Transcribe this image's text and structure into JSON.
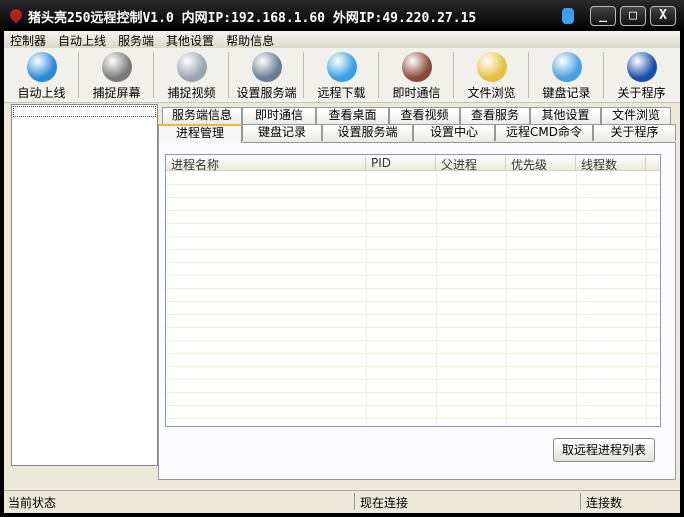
{
  "title": "猪头亮250远程控制V1.0 内网IP:192.168.1.60  外网IP:49.220.27.15",
  "window_buttons": {
    "minimize": "_",
    "maximize": "□",
    "close": "X"
  },
  "menu": [
    "控制器",
    "自动上线",
    "服务端",
    "其他设置",
    "帮助信息"
  ],
  "toolbar": [
    {
      "label": "自动上线",
      "icon": "globe-icon",
      "color": "#2a8ad8"
    },
    {
      "label": "捕捉屏幕",
      "icon": "camera-icon",
      "color": "#7a7a7a"
    },
    {
      "label": "捕捉视频",
      "icon": "webcam-icon",
      "color": "#9aa4ae"
    },
    {
      "label": "设置服务端",
      "icon": "toolbox-icon",
      "color": "#6a7f95"
    },
    {
      "label": "远程下载",
      "icon": "download-icon",
      "color": "#3a9ee0"
    },
    {
      "label": "即时通信",
      "icon": "heart-icon",
      "color": "#8a4a3a"
    },
    {
      "label": "文件浏览",
      "icon": "cabinet-icon",
      "color": "#e8c040"
    },
    {
      "label": "键盘记录",
      "icon": "computer-icon",
      "color": "#4aa0e0"
    },
    {
      "label": "关于程序",
      "icon": "help-icon",
      "color": "#1a4ea8"
    }
  ],
  "tabs_row1": [
    "服务端信息",
    "即时通信",
    "查看桌面",
    "查看视频",
    "查看服务",
    "其他设置",
    "文件浏览"
  ],
  "tabs_row2": [
    "进程管理",
    "键盘记录",
    "设置服务端",
    "设置中心",
    "远程CMD命令",
    "关于程序"
  ],
  "active_tab": "进程管理",
  "columns": [
    "进程名称",
    "PID",
    "父进程",
    "优先级",
    "线程数"
  ],
  "refresh_button": "取远程进程列表",
  "status": [
    "当前状态",
    "现在连接",
    "连接数"
  ]
}
